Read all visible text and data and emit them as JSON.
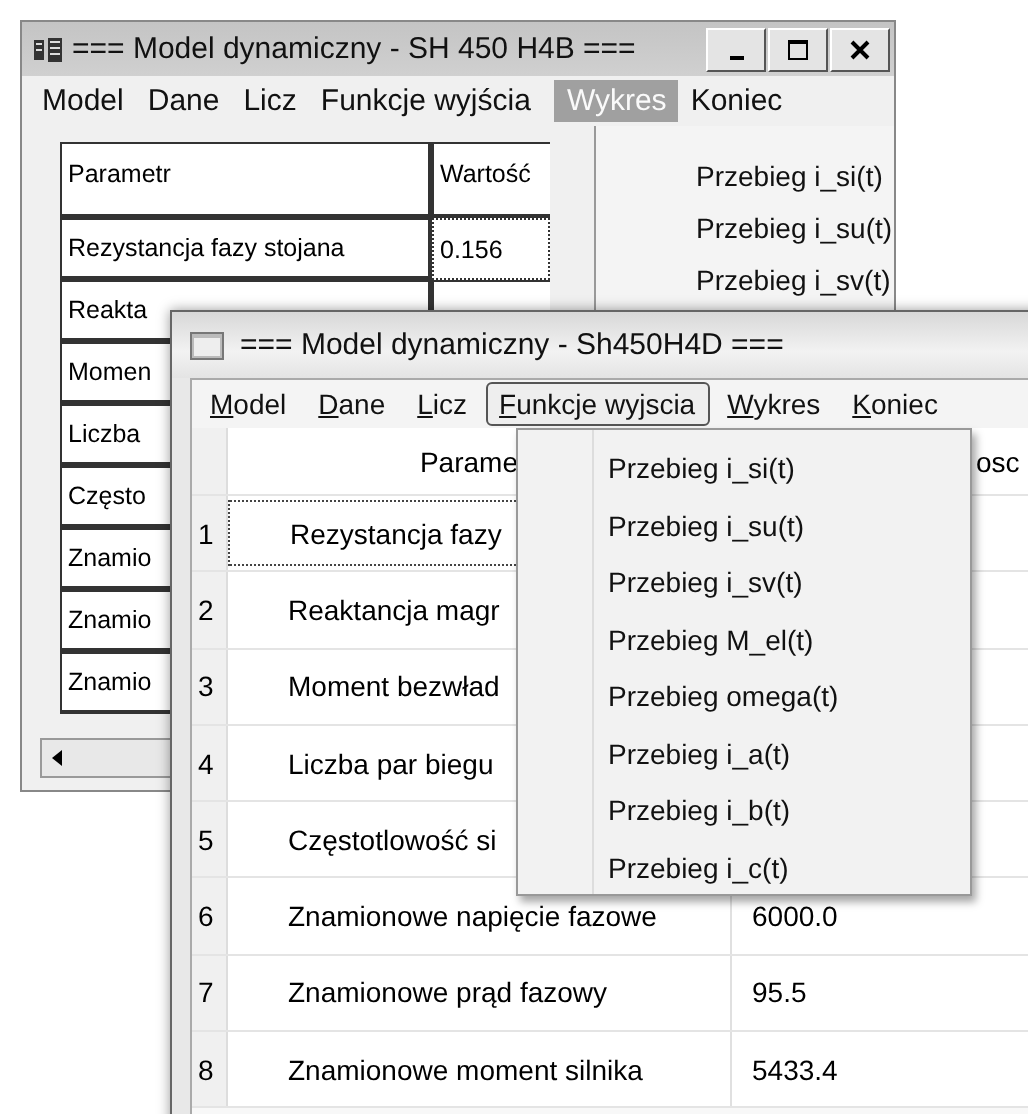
{
  "back_window": {
    "title": "=== Model dynamiczny - SH 450 H4B ===",
    "menu": [
      {
        "label": "Model",
        "selected": false
      },
      {
        "label": "Dane",
        "selected": false
      },
      {
        "label": "Licz",
        "selected": false
      },
      {
        "label": "Funkcje wyjścia",
        "selected": false
      },
      {
        "label": "Wykres",
        "selected": true
      },
      {
        "label": "Koniec",
        "selected": false
      }
    ],
    "open_menu": [
      "Przebieg i_si(t)",
      "Przebieg i_su(t)",
      "Przebieg i_sv(t)"
    ],
    "table": {
      "columns": [
        "Parametr",
        "Wartość"
      ],
      "rows": [
        {
          "parameter": "Rezystancja fazy stojana",
          "value": "0.156",
          "focused": true
        },
        {
          "parameter": "Reakta",
          "focused": false
        },
        {
          "parameter": "Momen"
        },
        {
          "parameter": "Liczba"
        },
        {
          "parameter": "Często"
        },
        {
          "parameter": "Znamio"
        },
        {
          "parameter": "Znamio"
        },
        {
          "parameter": "Znamio"
        }
      ]
    }
  },
  "front_window": {
    "title": "=== Model dynamiczny - Sh450H4D ===",
    "menu": [
      {
        "label": "Model",
        "selected": false
      },
      {
        "label": "Dane",
        "selected": false
      },
      {
        "label": "Licz",
        "selected": false
      },
      {
        "label": "Funkcje wyjscia",
        "selected": true
      },
      {
        "label": "Wykres",
        "selected": false
      },
      {
        "label": "Koniec",
        "selected": false
      }
    ],
    "open_menu": [
      "Przebieg i_si(t)",
      "Przebieg i_su(t)",
      "Przebieg i_sv(t)",
      "Przebieg M_el(t)",
      "Przebieg omega(t)",
      "Przebieg i_a(t)",
      "Przebieg i_b(t)",
      "Przebieg i_c(t)"
    ],
    "table": {
      "columns": [
        "Parame",
        "osc"
      ],
      "rows": [
        {
          "number": "1",
          "parameter": "Rezystancja fazy",
          "focused": true
        },
        {
          "number": "2",
          "parameter": "Reaktancja magr",
          "focused": false
        },
        {
          "number": "3",
          "parameter": "Moment bezwład",
          "focused": false
        },
        {
          "number": "4",
          "parameter": "Liczba par biegu",
          "focused": false
        },
        {
          "number": "5",
          "parameter": "Częstotlowość si",
          "focused": false
        },
        {
          "number": "6",
          "parameter": "Znamionowe napięcie fazowe",
          "value": "6000.0",
          "focused": false
        },
        {
          "number": "7",
          "parameter": "Znamionowe prąd fazowy",
          "value": "95.5",
          "focused": false
        },
        {
          "number": "8",
          "parameter": "Znamionowe moment silnika",
          "value": "5433.4",
          "focused": false
        }
      ]
    }
  }
}
